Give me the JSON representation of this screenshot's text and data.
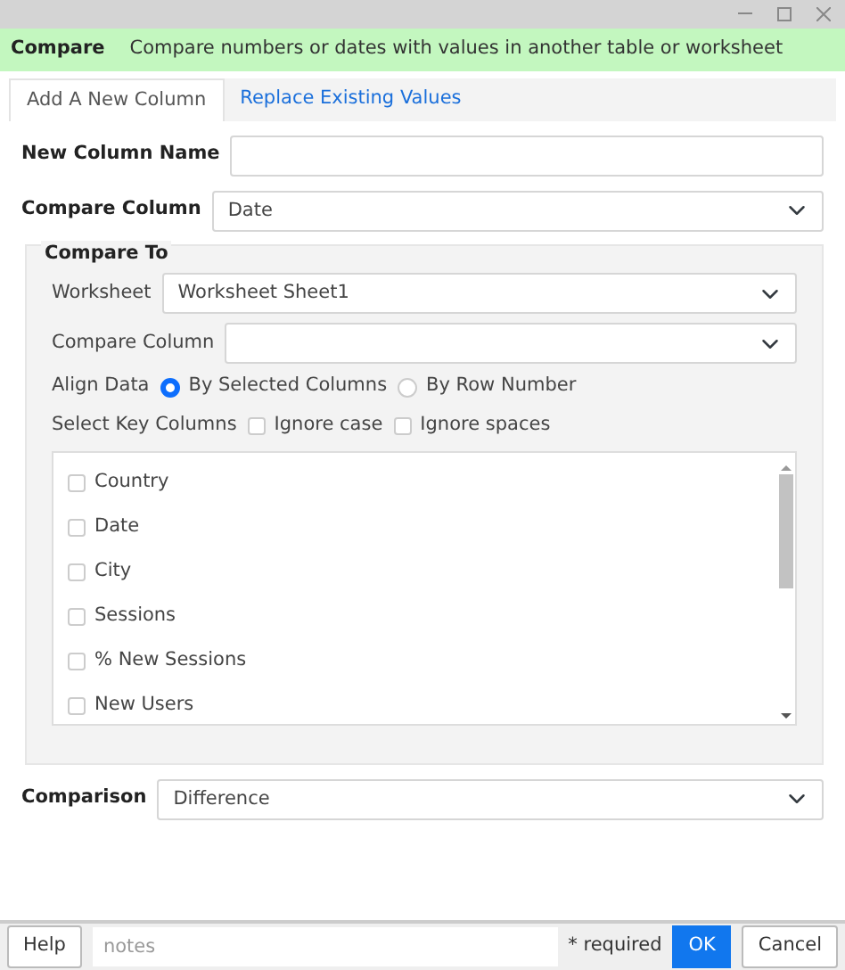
{
  "header": {
    "title": "Compare",
    "description": "Compare numbers or dates with values in another table or worksheet"
  },
  "tabs": [
    {
      "label": "Add A New Column",
      "selected": true
    },
    {
      "label": "Replace Existing Values",
      "selected": false
    }
  ],
  "new_column_name": {
    "label": "New Column Name"
  },
  "compare_column": {
    "label": "Compare Column",
    "value": "Date"
  },
  "compare_to": {
    "title": "Compare To",
    "worksheet": {
      "label": "Worksheet",
      "value": "Worksheet Sheet1"
    },
    "compare_column": {
      "label": "Compare Column"
    },
    "align_data": {
      "label": "Align Data",
      "options": [
        {
          "label": "By Selected Columns",
          "selected": true
        },
        {
          "label": "By Row Number",
          "selected": false
        }
      ]
    },
    "key_columns": {
      "label": "Select Key Columns",
      "options": [
        {
          "label": "Ignore case",
          "checked": false
        },
        {
          "label": "Ignore spaces",
          "checked": false
        }
      ]
    },
    "columns": [
      {
        "label": "Country",
        "checked": false
      },
      {
        "label": "Date",
        "checked": false
      },
      {
        "label": "City",
        "checked": false
      },
      {
        "label": "Sessions",
        "checked": false
      },
      {
        "label": "% New Sessions",
        "checked": false
      },
      {
        "label": "New Users",
        "checked": false
      }
    ]
  },
  "comparison": {
    "label": "Comparison",
    "value": "Difference"
  },
  "footer": {
    "help": "Help",
    "notes_placeholder": "notes",
    "required": "* required",
    "ok": "OK",
    "cancel": "Cancel"
  }
}
